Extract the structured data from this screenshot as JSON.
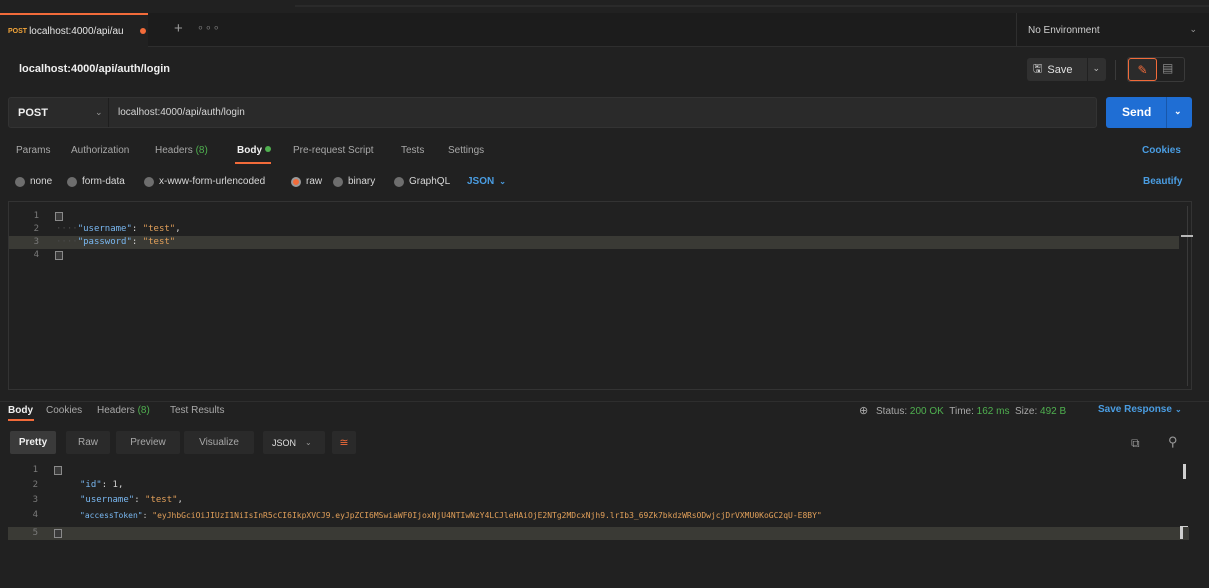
{
  "tab": {
    "method": "POST",
    "name": "localhost:4000/api/au",
    "plus": "+",
    "more": "∘∘∘"
  },
  "environment": {
    "label": "No Environment",
    "chevron": "⌄"
  },
  "request": {
    "title": "localhost:4000/api/auth/login",
    "method": "POST",
    "url": "localhost:4000/api/auth/login"
  },
  "toolbar": {
    "save_label": "Save",
    "send_label": "Send"
  },
  "request_tabs": [
    {
      "label": "Params"
    },
    {
      "label": "Authorization"
    },
    {
      "label": "Headers",
      "count": "(8)"
    },
    {
      "label": "Body"
    },
    {
      "label": "Pre-request Script"
    },
    {
      "label": "Tests"
    },
    {
      "label": "Settings"
    }
  ],
  "cookies_label": "Cookies",
  "body_types": [
    {
      "label": "none",
      "selected": false
    },
    {
      "label": "form-data",
      "selected": false
    },
    {
      "label": "x-www-form-urlencoded",
      "selected": false
    },
    {
      "label": "raw",
      "selected": true
    },
    {
      "label": "binary",
      "selected": false
    },
    {
      "label": "GraphQL",
      "selected": false
    }
  ],
  "body_format": "JSON",
  "beautify_label": "Beautify",
  "request_body": {
    "line_numbers": [
      "1",
      "2",
      "3",
      "4"
    ],
    "username_key": "\"username\"",
    "username_value": "\"test\"",
    "password_key": "\"password\"",
    "password_value": "\"test\""
  },
  "response_tabs": [
    {
      "label": "Body"
    },
    {
      "label": "Cookies"
    },
    {
      "label": "Headers",
      "count": "(8)"
    },
    {
      "label": "Test Results"
    }
  ],
  "response_status": {
    "status_label": "Status:",
    "status_value": "200 OK",
    "time_label": "Time:",
    "time_value": "162 ms",
    "size_label": "Size:",
    "size_value": "492 B",
    "save_response": "Save Response"
  },
  "view_modes": [
    "Pretty",
    "Raw",
    "Preview",
    "Visualize"
  ],
  "response_format": "JSON",
  "response_body": {
    "line_numbers": [
      "1",
      "2",
      "3",
      "4",
      "5"
    ],
    "id_key": "\"id\"",
    "id_value": "1",
    "username_key": "\"username\"",
    "username_value": "\"test\"",
    "token_key": "\"accessToken\"",
    "token_value": "\"eyJhbGciOiJIUzI1NiIsInR5cCI6IkpXVCJ9.eyJpZCI6MSwiaWF0IjoxNjU4NTIwNzY4LCJleHAiOjE2NTg2MDcxNjh9.lrIb3_69Zk7bkdzWRsODwjcjDrVXMU0KoGC2qU-E8BY\""
  },
  "colors": {
    "accent": "#f26b3a",
    "send": "#1f6ed4",
    "link": "#4a9de2",
    "success": "#4fb04f",
    "json_key": "#79b7f0",
    "json_string": "#e2a05a"
  }
}
